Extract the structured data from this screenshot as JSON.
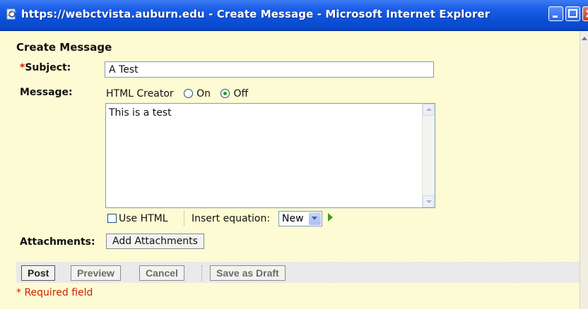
{
  "window": {
    "title": "https://webctvista.auburn.edu - Create Message - Microsoft Internet Explorer"
  },
  "form": {
    "heading": "Create Message",
    "required_star": "*",
    "subject_label": "Subject:",
    "subject_value": "A Test",
    "message_label": "Message:",
    "html_creator_label": "HTML Creator",
    "html_creator_on": "On",
    "html_creator_off": "Off",
    "html_creator_selected": "Off",
    "message_text": "This is a test",
    "use_html_label": "Use HTML",
    "use_html_checked": false,
    "insert_equation_label": "Insert equation:",
    "insert_equation_value": "New",
    "attachments_label": "Attachments:",
    "add_attachments_label": "Add Attachments"
  },
  "toolbar": {
    "post": "Post",
    "preview": "Preview",
    "cancel": "Cancel",
    "save_draft": "Save as Draft"
  },
  "required_note": "* Required field"
}
